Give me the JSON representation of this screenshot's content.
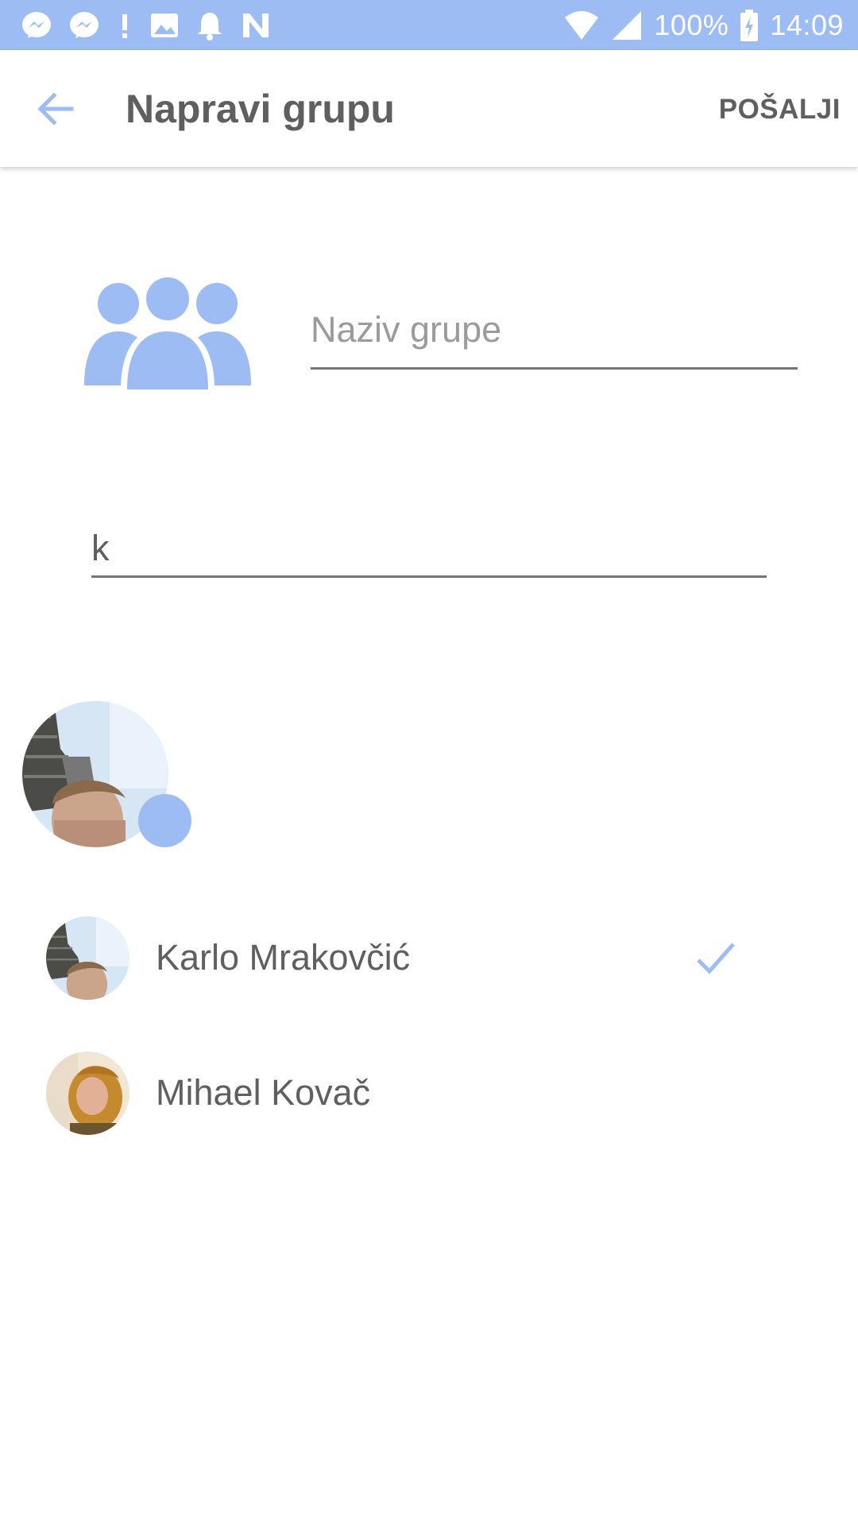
{
  "status_bar": {
    "icons": [
      "messenger-icon",
      "messenger-icon",
      "alert-icon",
      "image-icon",
      "bell-icon",
      "n-icon",
      "wifi-icon",
      "signal-icon",
      "battery-icon"
    ],
    "battery": "100%",
    "time": "14:09"
  },
  "app_bar": {
    "title": "Napravi grupu",
    "send_label": "POŠALJI"
  },
  "group_name": {
    "placeholder": "Naziv grupe",
    "value": ""
  },
  "search": {
    "value": "k"
  },
  "contacts": [
    {
      "name": "Karlo Mrakovčić",
      "selected": true
    },
    {
      "name": "Mihael Kovač",
      "selected": false
    }
  ],
  "colors": {
    "accent": "#9cbcf3",
    "text": "#5f5f5f",
    "placeholder": "#9b9b9b"
  }
}
